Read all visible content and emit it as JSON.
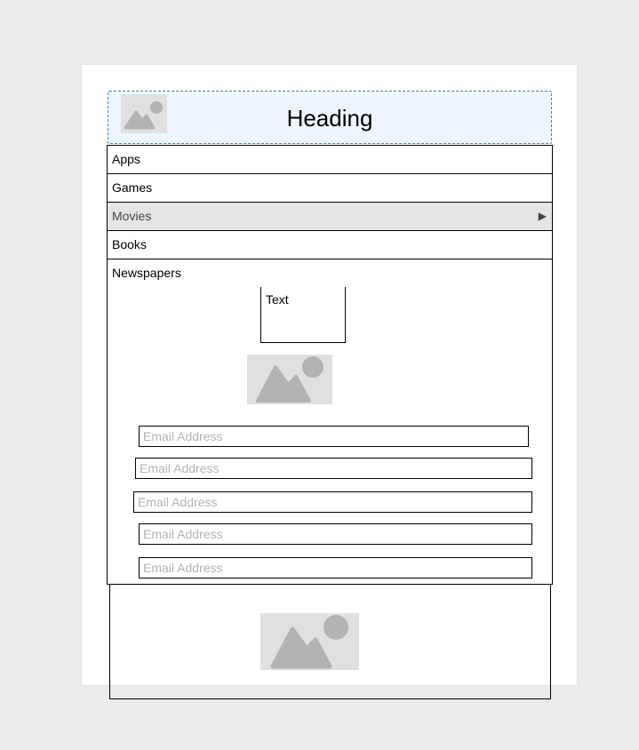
{
  "header": {
    "heading": "Heading",
    "logo_icon": "image-placeholder-icon",
    "background": "#eef5ff",
    "border_color": "#3d8b9a"
  },
  "menu": {
    "items": [
      {
        "label": "Apps"
      },
      {
        "label": "Games"
      },
      {
        "label": "Movies",
        "selected": true,
        "has_submenu": true
      },
      {
        "label": "Books"
      },
      {
        "label": "Newspapers"
      }
    ],
    "submenu_indicator": "▶"
  },
  "content": {
    "text_box": "Text",
    "image_icon": "image-placeholder-icon",
    "email_fields": [
      {
        "placeholder": "Email Address",
        "value": ""
      },
      {
        "placeholder": "Email Address",
        "value": ""
      },
      {
        "placeholder": "Email Address",
        "value": ""
      },
      {
        "placeholder": "Email Address",
        "value": ""
      },
      {
        "placeholder": "Email Address",
        "value": ""
      }
    ]
  },
  "footer": {
    "image_icon": "image-placeholder-icon"
  },
  "colors": {
    "page_background": "#ececec",
    "card_background": "#ffffff",
    "selected_item": "#e5e5e5",
    "placeholder_fill": "#e0e0e0",
    "placeholder_glyph": "#b3b3b3"
  }
}
